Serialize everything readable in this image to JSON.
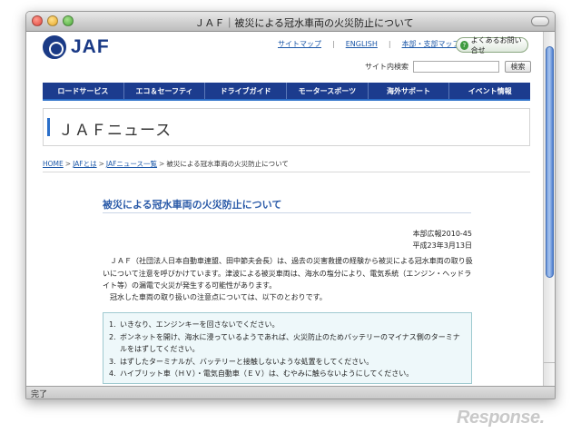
{
  "window": {
    "title": "ＪＡＦ｜被災による冠水車両の火災防止について",
    "status": "完了"
  },
  "site": {
    "logo_text": "JAF",
    "top_links": [
      "サイトマップ",
      "ENGLISH",
      "本部・支部マップ"
    ],
    "faq_button": "よくあるお問い合せ",
    "search_label": "サイト内検索",
    "search_value": "",
    "search_button": "検索",
    "nav": [
      "ロードサービス",
      "エコ＆セーフティ",
      "ドライブガイド",
      "モータースポーツ",
      "海外サポート",
      "イベント情報"
    ],
    "section_title": "ＪＡＦニュース"
  },
  "breadcrumb": {
    "home": "HOME",
    "about": "JAFとは",
    "news_list": "JAFニュース一覧",
    "current": "被災による冠水車両の火災防止について"
  },
  "article": {
    "title": "被災による冠水車両の火災防止について",
    "number": "本部広報2010-45",
    "date": "平成23年3月13日",
    "paragraph1": "　ＪＡＦ（社団法人日本自動車連盟、田中節夫会長）は、過去の災害救援の経験から被災による冠水車両の取り扱いについて注意を呼びかけています。津波による被災車両は、海水の塩分により、電気系統（エンジン・ヘッドライト等）の漏電で火災が発生する可能性があります。",
    "paragraph2": "　冠水した車両の取り扱いの注意点については、以下のとおりです。",
    "notices": [
      {
        "num": "1.",
        "text": "いきなり、エンジンキーを回さないでください。"
      },
      {
        "num": "2.",
        "text": "ボンネットを開け、海水に浸っているようであれば、火災防止のためバッテリーのマイナス側のターミナルをはずしてください。"
      },
      {
        "num": "3.",
        "text": "はずしたターミナルが、バッテリーと接触しないような処置をしてください。"
      },
      {
        "num": "4.",
        "text": "ハイブリット車（ＨＶ）・電気自動車（ＥＶ）は、むやみに触らないようにしてください。"
      }
    ]
  },
  "watermark": "Response."
}
